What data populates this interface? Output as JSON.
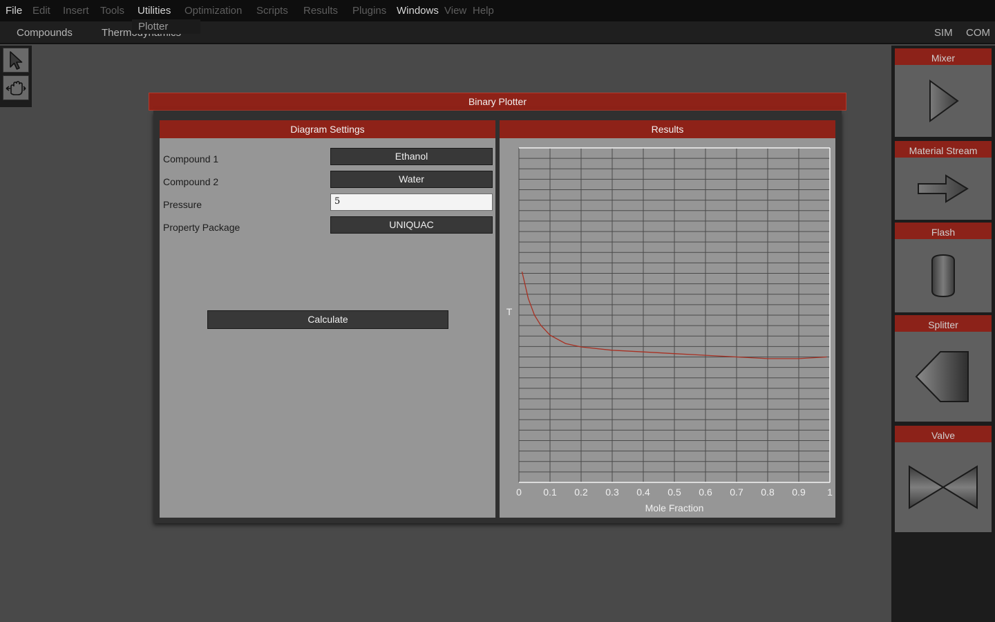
{
  "menubar": {
    "items": [
      {
        "label": "File",
        "active": true
      },
      {
        "label": "Edit",
        "active": false
      },
      {
        "label": "Insert",
        "active": false
      },
      {
        "label": "Tools",
        "active": false
      },
      {
        "label": "Utilities",
        "active": true
      },
      {
        "label": "Optimization",
        "active": false
      },
      {
        "label": "Scripts",
        "active": false
      },
      {
        "label": "Results",
        "active": false
      },
      {
        "label": "Plugins",
        "active": false
      },
      {
        "label": "Windows",
        "active": true
      },
      {
        "label": "View",
        "active": false
      },
      {
        "label": "Help",
        "active": false
      }
    ]
  },
  "utilities_menu": {
    "items": [
      "Plotter"
    ]
  },
  "subbar": {
    "left": [
      "Compounds",
      "Thermodynamics"
    ],
    "right": [
      "SIM",
      "COM"
    ]
  },
  "tools": [
    {
      "icon": "pointer-icon"
    },
    {
      "icon": "hand-pan-icon"
    }
  ],
  "components": [
    {
      "label": "Mixer",
      "icon": "mixer-triangle-icon"
    },
    {
      "label": "Material Stream",
      "icon": "stream-arrow-icon"
    },
    {
      "label": "Flash",
      "icon": "flash-vessel-icon"
    },
    {
      "label": "Splitter",
      "icon": "splitter-icon"
    },
    {
      "label": "Valve",
      "icon": "valve-icon"
    }
  ],
  "window": {
    "title": "Binary Plotter",
    "settings": {
      "header": "Diagram Settings",
      "compound1": {
        "label": "Compound 1",
        "value": "Ethanol"
      },
      "compound2": {
        "label": "Compound 2",
        "value": "Water"
      },
      "pressure": {
        "label": "Pressure",
        "value": "5"
      },
      "property_package": {
        "label": "Property Package",
        "value": "UNIQUAC"
      },
      "calculate_label": "Calculate"
    },
    "results": {
      "header": "Results"
    }
  },
  "chart_data": {
    "type": "line",
    "title": "",
    "xlabel": "Mole Fraction",
    "ylabel": "T",
    "xlim": [
      0,
      1
    ],
    "x_ticks": [
      "0",
      "0.1",
      "0.2",
      "0.3",
      "0.4",
      "0.5",
      "0.6",
      "0.7",
      "0.8",
      "0.9",
      "1"
    ],
    "y_grid_lines": 32,
    "grid": true,
    "series": [
      {
        "color": "#a93022",
        "x": [
          0.01,
          0.02,
          0.03,
          0.05,
          0.07,
          0.1,
          0.15,
          0.2,
          0.3,
          0.4,
          0.5,
          0.6,
          0.7,
          0.8,
          0.9,
          0.99
        ],
        "y_fraction_of_plot": [
          0.37,
          0.41,
          0.45,
          0.5,
          0.53,
          0.56,
          0.585,
          0.595,
          0.605,
          0.61,
          0.615,
          0.62,
          0.625,
          0.63,
          0.63,
          0.625
        ]
      }
    ]
  }
}
